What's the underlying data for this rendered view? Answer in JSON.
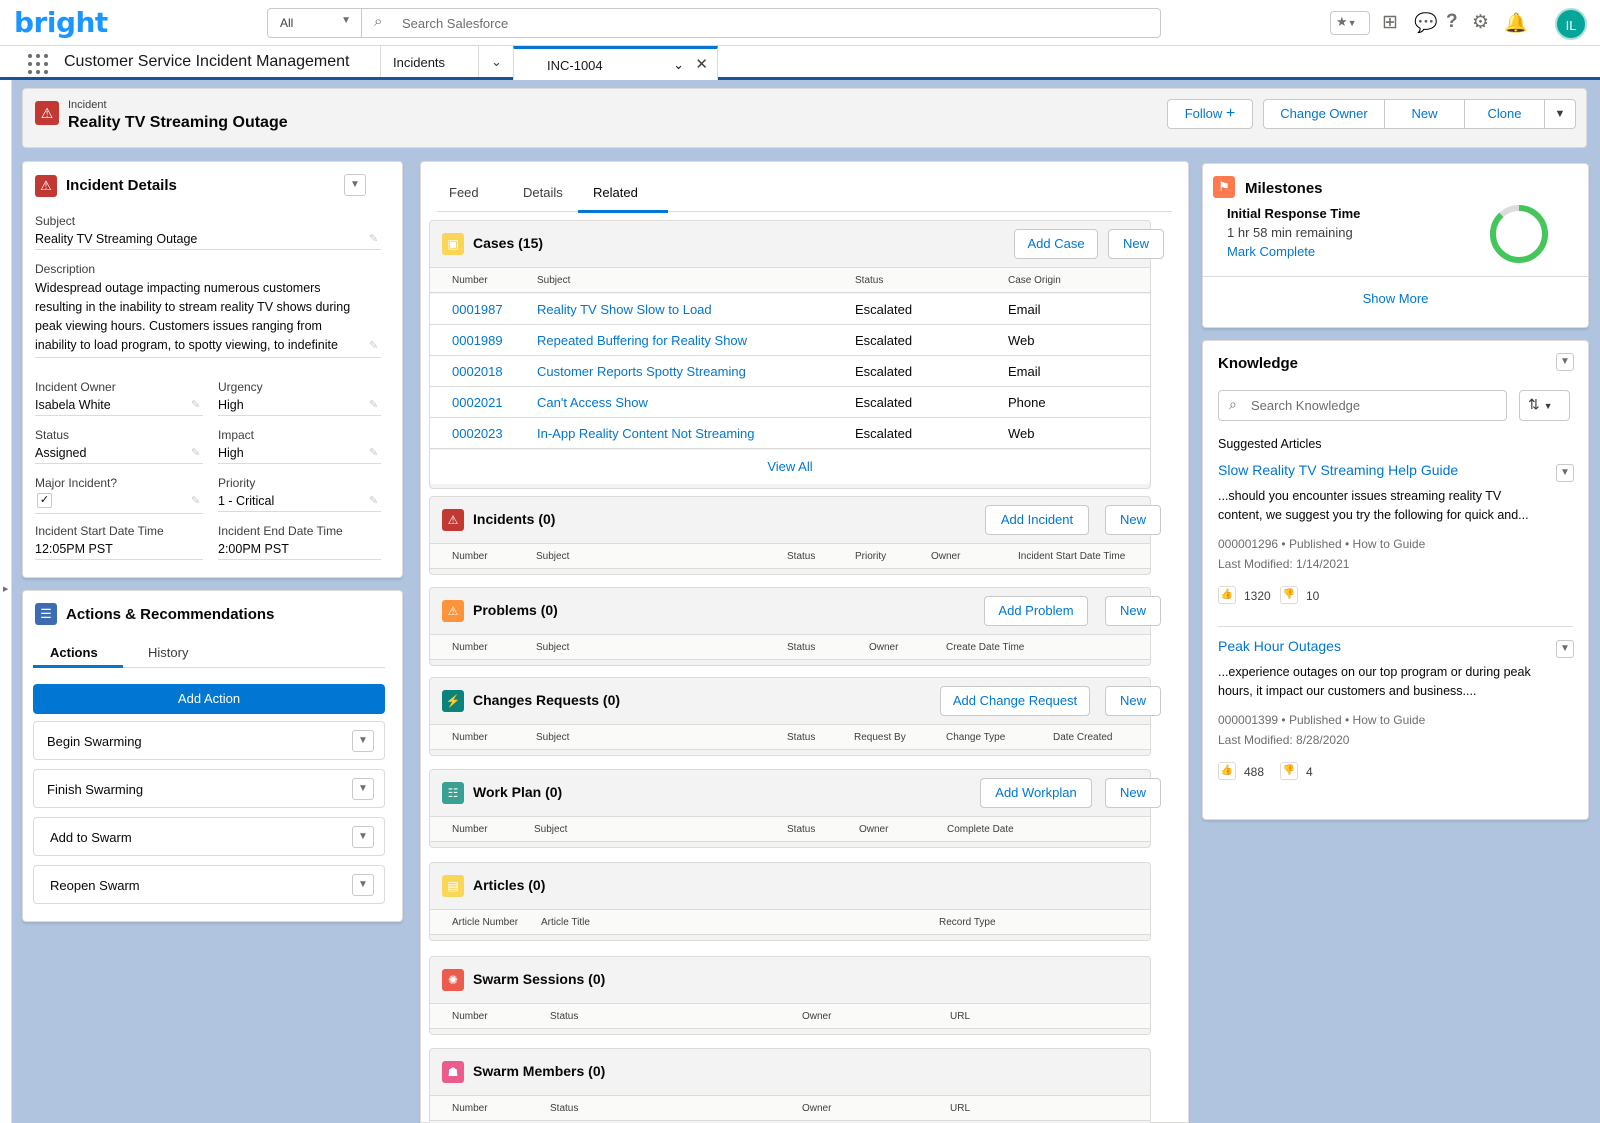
{
  "header": {
    "logo": "bright",
    "scope": "All",
    "search_placeholder": "Search Salesforce",
    "avatar_initials": "IL"
  },
  "nav": {
    "app_name": "Customer Service Incident Management",
    "object_tab": "Incidents",
    "record_tab": "INC-1004"
  },
  "record": {
    "type": "Incident",
    "title": "Reality TV Streaming Outage",
    "buttons": {
      "follow": "Follow",
      "change_owner": "Change Owner",
      "new": "New",
      "clone": "Clone"
    }
  },
  "details": {
    "title": "Incident Details",
    "subject_label": "Subject",
    "subject": "Reality TV Streaming Outage",
    "description_label": "Description",
    "description_lines": [
      "Widespread outage impacting numerous customers",
      "resulting in the inability to stream reality TV shows during",
      "peak viewing hours. Customers issues ranging from",
      "inability to load program, to spotty viewing, to indefinite"
    ],
    "owner_label": "Incident Owner",
    "owner": "Isabela White",
    "urgency_label": "Urgency",
    "urgency": "High",
    "status_label": "Status",
    "status": "Assigned",
    "impact_label": "Impact",
    "impact": "High",
    "major_label": "Major Incident?",
    "major": true,
    "priority_label": "Priority",
    "priority": "1 - Critical",
    "start_label": "Incident Start Date Time",
    "start": "12:05PM PST",
    "end_label": "Incident End Date Time",
    "end": "2:00PM PST"
  },
  "actions": {
    "title": "Actions & Recommendations",
    "tabs": [
      "Actions",
      "History"
    ],
    "add_action": "Add Action",
    "items": [
      "Begin Swarming",
      "Finish Swarming",
      "Add to Swarm",
      "Reopen Swarm"
    ]
  },
  "center_tabs": [
    "Feed",
    "Details",
    "Related"
  ],
  "cases": {
    "title": "Cases (15)",
    "add": "Add Case",
    "new": "New",
    "columns": [
      "Number",
      "Subject",
      "Status",
      "Case Origin"
    ],
    "rows": [
      [
        "0001987",
        "Reality TV Show Slow to Load",
        "Escalated",
        "Email"
      ],
      [
        "0001989",
        "Repeated Buffering for Reality Show",
        "Escalated",
        "Web"
      ],
      [
        "0002018",
        "Customer Reports Spotty Streaming",
        "Escalated",
        "Email"
      ],
      [
        "0002021",
        "Can't Access Show",
        "Escalated",
        "Phone"
      ],
      [
        "0002023",
        "In-App Reality Content Not Streaming",
        "Escalated",
        "Web"
      ]
    ],
    "view_all": "View All"
  },
  "incidents": {
    "title": "Incidents (0)",
    "add": "Add Incident",
    "new": "New",
    "columns": [
      "Number",
      "Subject",
      "Status",
      "Priority",
      "Owner",
      "Incident Start Date Time"
    ]
  },
  "problems": {
    "title": "Problems (0)",
    "add": "Add Problem",
    "new": "New",
    "columns": [
      "Number",
      "Subject",
      "Status",
      "Owner",
      "Create Date Time"
    ]
  },
  "changes": {
    "title": "Changes Requests (0)",
    "add": "Add Change Request",
    "new": "New",
    "columns": [
      "Number",
      "Subject",
      "Status",
      "Request By",
      "Change Type",
      "Date Created"
    ]
  },
  "workplan": {
    "title": "Work Plan (0)",
    "add": "Add Workplan",
    "new": "New",
    "columns": [
      "Number",
      "Subject",
      "Status",
      "Owner",
      "Complete Date"
    ]
  },
  "articles": {
    "title": "Articles (0)",
    "columns": [
      "Article Number",
      "Article Title",
      "Record Type"
    ]
  },
  "swarm_sessions": {
    "title": "Swarm Sessions (0)",
    "columns": [
      "Number",
      "Status",
      "Owner",
      "URL"
    ]
  },
  "swarm_members": {
    "title": "Swarm Members (0)",
    "columns": [
      "Number",
      "Status",
      "Owner",
      "URL"
    ]
  },
  "milestones": {
    "title": "Milestones",
    "name": "Initial Response Time",
    "remaining": "1 hr 58 min remaining",
    "mark_complete": "Mark Complete",
    "show_more": "Show More",
    "progress_fraction": 0.88
  },
  "knowledge": {
    "title": "Knowledge",
    "search_placeholder": "Search Knowledge",
    "suggested": "Suggested Articles",
    "articles": [
      {
        "title": "Slow Reality TV Streaming Help Guide",
        "snippet": "...should you encounter issues streaming reality TV content, we suggest you try the following for quick and...",
        "number": "000001296",
        "status": "Published",
        "type": "How to Guide",
        "modified": "Last Modified: 1/14/2021",
        "up": "1320",
        "down": "10"
      },
      {
        "title": "Peak Hour Outages",
        "snippet": "...experience outages on our top program or during peak hours, it impact our customers and business....",
        "number": "000001399",
        "status": "Published",
        "type": "How to Guide",
        "modified": "Last Modified: 8/28/2020",
        "up": "488",
        "down": "4"
      }
    ]
  },
  "colors": {
    "brand_blue": "#0176d3",
    "incident_red": "#c23934",
    "milestone_green": "#45c65a",
    "background": "#b0c4df"
  }
}
